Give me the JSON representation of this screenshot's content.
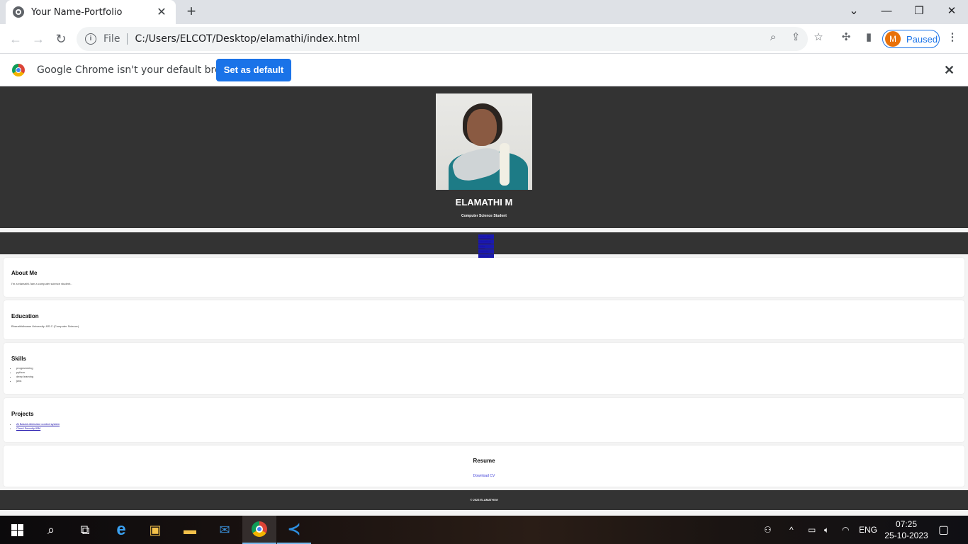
{
  "browser": {
    "tab_title": "Your Name-Portfolio",
    "tab_close": "✕",
    "new_tab": "+",
    "address_scheme": "File",
    "address_url": "C:/Users/ELCOT/Desktop/elamathi/index.html",
    "profile_initial": "M",
    "profile_status": "Paused",
    "window_controls": {
      "minimize": "—",
      "restore": "❐",
      "close": "✕",
      "tabsearch": "⌄"
    }
  },
  "infobar": {
    "message": "Google Chrome isn't your default browser",
    "button": "Set as default",
    "close": "✕"
  },
  "page": {
    "hero": {
      "name": "ELAMATHI M",
      "role": "Computer Science Student"
    },
    "nav": {
      "links": [
        "About Me",
        "Education",
        "Skills",
        "Projects",
        "Resume"
      ]
    },
    "about": {
      "heading": "About Me",
      "text": "I'm a elamathi.I'am a computer science student.."
    },
    "education": {
      "heading": "Education",
      "text": "Bharathidhasan University -BS.C (Computer Science)"
    },
    "skills": {
      "heading": "Skills",
      "items": [
        "programming",
        "python",
        "deep learning",
        "java"
      ]
    },
    "projects": {
      "heading": "Projects",
      "items": [
        "AI Based alternator control system",
        "Cloud Security IBM"
      ]
    },
    "resume": {
      "heading": "Resume",
      "link": "Download CV"
    },
    "footer": "© 2023 ELAMATHI M"
  },
  "taskbar": {
    "language": "ENG",
    "time": "07:25",
    "date": "25-10-2023"
  }
}
